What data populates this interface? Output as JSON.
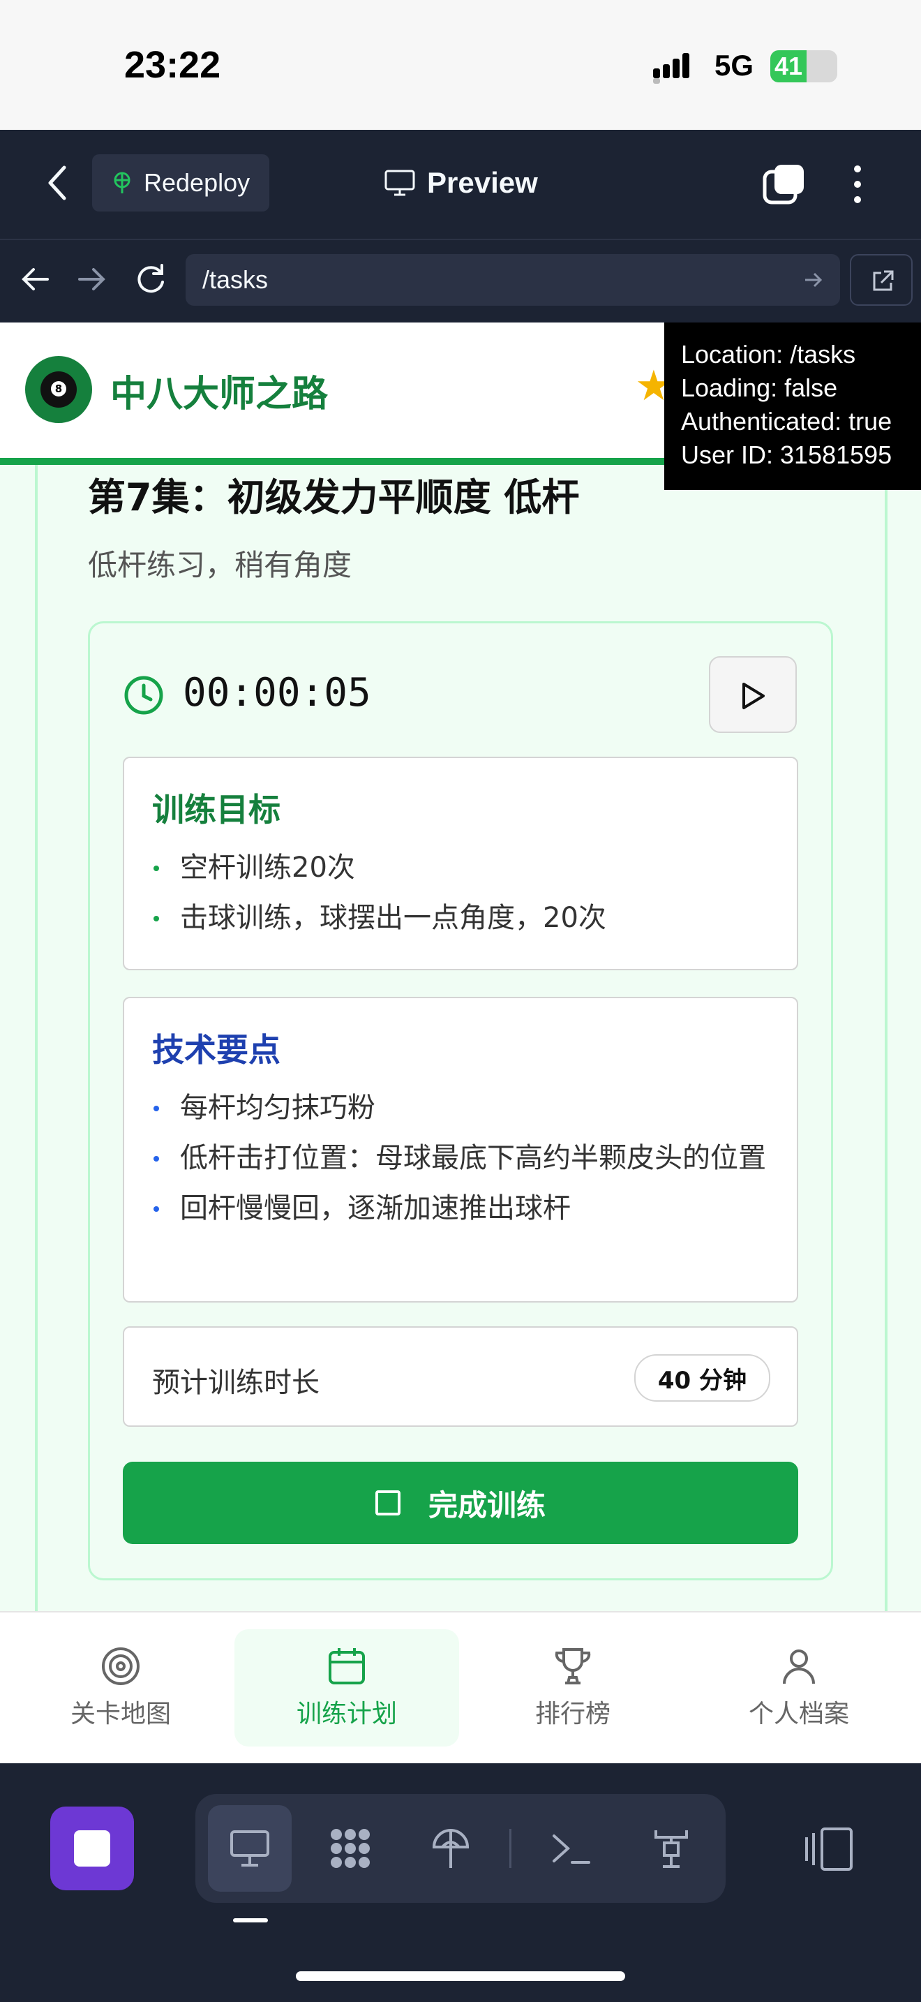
{
  "status_bar": {
    "time": "23:22",
    "network": "5G",
    "battery": "41"
  },
  "replit": {
    "redeploy_label": "Redeploy",
    "preview_label": "Preview",
    "url": "/tasks"
  },
  "app": {
    "title": "中八大师之路",
    "debug": {
      "location": "Location: /tasks",
      "loading": "Loading: false",
      "authenticated": "Authenticated: true",
      "user_id": "User ID: 31581595"
    },
    "episode": {
      "title": "第7集：初级发力平顺度 低杆",
      "subtitle": "低杆练习，稍有角度",
      "timer": "00:00:05",
      "goals": {
        "heading": "训练目标",
        "items": [
          "空杆训练20次",
          "击球训练，球摆出一点角度，20次"
        ]
      },
      "tech": {
        "heading": "技术要点",
        "items": [
          "每杆均匀抹巧粉",
          "低杆击打位置：母球最底下高约半颗皮头的位置",
          "回杆慢慢回，逐渐加速推出球杆"
        ]
      },
      "duration": {
        "label": "预计训练时长",
        "value": "40 分钟"
      },
      "complete_label": "完成训练"
    },
    "nav": [
      {
        "label": "关卡地图",
        "icon": "target-icon",
        "active": false
      },
      {
        "label": "训练计划",
        "icon": "calendar-icon",
        "active": true
      },
      {
        "label": "排行榜",
        "icon": "trophy-icon",
        "active": false
      },
      {
        "label": "个人档案",
        "icon": "user-icon",
        "active": false
      }
    ]
  },
  "colors": {
    "primary_green": "#16a34a",
    "dark_green": "#15803d",
    "blue": "#1e40af",
    "replit_bg": "#1c2333",
    "stop_purple": "#6d38d4"
  }
}
